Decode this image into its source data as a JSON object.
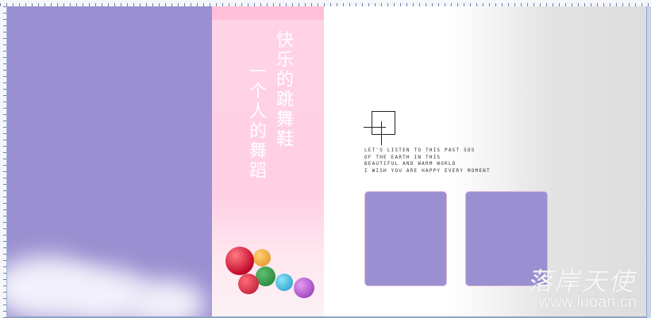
{
  "poem": {
    "line1": "快乐的跳舞鞋",
    "line2": "一个人的舞蹈"
  },
  "english_text": "LET'S LISTEN TO THIS PAST SOS\nOF THE EARTH IN THIS\nBEAUTIFUL AND WARM WORLD\nI WISH YOU ARE HAPPY EVERY MOMENT",
  "watermark": {
    "brand": "落岸天使",
    "url": "www.luoan.cn"
  },
  "colors": {
    "lavender": "#9a8fd1",
    "pink": "#ffd3e6",
    "pink_strip": "#ffbfd8"
  },
  "icons": [
    "ruler-top",
    "ruler-left",
    "scrollbar"
  ]
}
